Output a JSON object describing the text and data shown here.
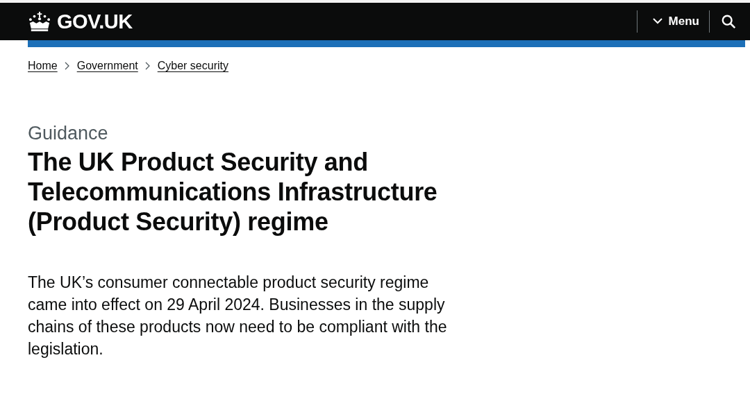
{
  "header": {
    "logo": "GOV.UK",
    "menu": "Menu"
  },
  "breadcrumbs": [
    {
      "label": "Home"
    },
    {
      "label": "Government"
    },
    {
      "label": "Cyber security"
    }
  ],
  "caption": "Guidance",
  "title": "The UK Product Security and Telecommunications Infrastructure (Product Security) regime",
  "lead": "The UK’s consumer connectable product security regime came into effect on 29 April 2024. Businesses in the supply chains of these products now need to be compliant with the legislation."
}
